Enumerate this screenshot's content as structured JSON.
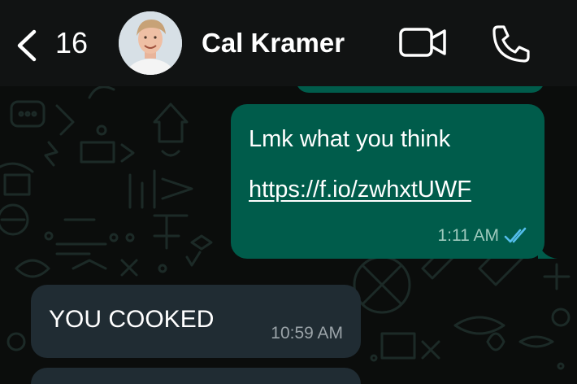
{
  "colors": {
    "outgoing_bubble": "#005c4b",
    "incoming_bubble": "#202c33",
    "header_bg": "#111313",
    "chat_bg": "#0b0d0c",
    "read_receipt": "#53bdeb"
  },
  "header": {
    "back_icon": "chevron-left-icon",
    "unread_count": "16",
    "contact_name": "Cal Kramer",
    "video_icon": "video-camera-icon",
    "call_icon": "phone-icon"
  },
  "messages": [
    {
      "direction": "outgoing",
      "text": "Lmk what you think",
      "link": "https://f.io/zwhxtUWF",
      "time": "1:11 AM",
      "status_icon": "double-check-icon"
    },
    {
      "direction": "incoming",
      "text": "YOU COOKED",
      "time": "10:59 AM"
    }
  ]
}
